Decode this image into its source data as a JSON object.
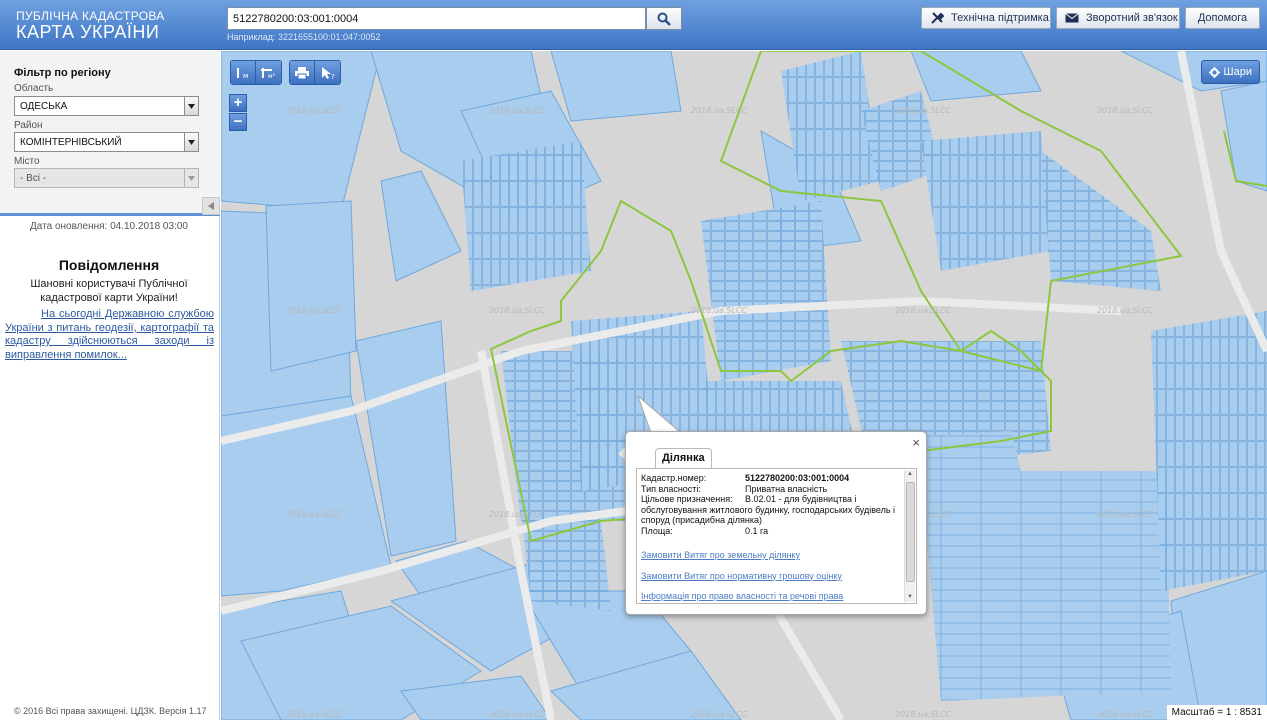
{
  "header": {
    "logo_line1": "ПУБЛІЧНА КАДАСТРОВА",
    "logo_line2": "КАРТА УКРАЇНИ",
    "search_value": "5122780200:03:001:0004",
    "search_hint": "Наприклад: 3221655100:01:047:0052",
    "buttons": {
      "support": "Технічна підтримка",
      "feedback": "Зворотний зв'язок",
      "help": "Допомога"
    },
    "icons": {
      "search": "search-icon",
      "support": "tools-icon",
      "feedback": "envelope-icon"
    }
  },
  "sidebar": {
    "filter_title": "Фільтр по регіону",
    "oblast_label": "Область",
    "oblast_value": "ОДЕСЬКА",
    "raion_label": "Район",
    "raion_value": "КОМІНТЕРНІВСЬКИЙ",
    "misto_label": "Місто",
    "misto_value": "- Всі -",
    "update_date": "Дата оновлення: 04.10.2018 03:00",
    "messages_title": "Повідомлення",
    "greeting": "Шановні користувачі Публічної кадастрової карти України!",
    "message_link": "На сьогодні Державною службою України з питань геодезії, картографії та кадастру здійснюються заходи із виправлення помилок...",
    "copyright": "© 2016 Всі права захищені. ЦДЗК. Версія 1.17"
  },
  "map": {
    "tools": [
      "measure-length",
      "measure-area",
      "print",
      "identify"
    ],
    "zoom_in": "+",
    "zoom_out": "−",
    "layers_label": "Шари",
    "scale_text": "Масштаб = 1 : 8531",
    "watermark": "2018.ua.SLCC",
    "colors": {
      "parcel_fill": "#a9cdee",
      "parcel_stroke": "#6fa8dc",
      "boundary": "#8dc63f",
      "background": "#d6d6d6"
    }
  },
  "popup": {
    "tab": "Ділянка",
    "close": "×",
    "fields": [
      {
        "key": "Кадастр.номер:",
        "value": "5122780200:03:001:0004",
        "bold": true
      },
      {
        "key": "Тип власності:",
        "value": "Приватна власність",
        "bold": false
      },
      {
        "key": "Цільове призначення:",
        "value": "В.02.01 - для будівництва і",
        "bold": false
      }
    ],
    "purpose_continued": "обслуговування житлового будинку, господарських будівель і споруд (присадибна ділянка)",
    "area_key": "Площа:",
    "area_value": "0.1 га",
    "links": [
      "Замовити Витяг про земельну ділянку",
      "Замовити Витяг про нормативну грошову оцінку",
      "Інформація про право власності та речові права"
    ]
  }
}
